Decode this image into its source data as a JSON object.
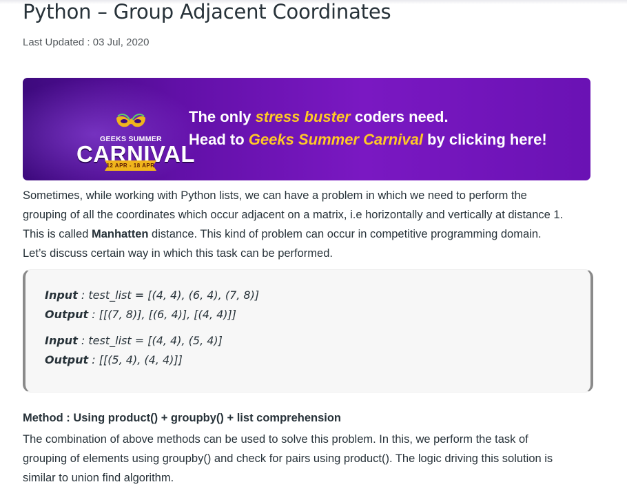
{
  "article": {
    "title": "Python – Group Adjacent Coordinates",
    "last_updated": "Last Updated : 03 Jul, 2020"
  },
  "banner": {
    "logo_line1": "GEEKS SUMMER",
    "logo_line2": "CARNIVAL",
    "logo_dates": "12 APR - 18 APR",
    "line1_start": "The only ",
    "line1_highlight": "stress buster",
    "line1_end": " coders need.",
    "line2_start": "Head to ",
    "line2_highlight": "Geeks Summer Carnival",
    "line2_end": " by clicking here!",
    "highlight_color": "#ffc926"
  },
  "intro": {
    "line1": "Sometimes, while working with Python lists, we can have a problem in which we need to perform the",
    "line2": "grouping of all the coordinates which occur adjacent on a matrix, i.e horizontally and vertically at distance 1.",
    "line3_start": "This is called ",
    "line3_bold": "Manhatten",
    "line3_end": " distance. This kind of problem can occur in competitive programming domain.",
    "line4": "Let’s discuss certain way in which this task can be performed."
  },
  "examples": [
    {
      "input_label": "Input",
      "input_text": " : test_list = [(4, 4), (6, 4), (7, 8)]",
      "output_label": "Output",
      "output_text": " : [[(7, 8)], [(6, 4)], [(4, 4)]]"
    },
    {
      "input_label": "Input",
      "input_text": " : test_list = [(4, 4), (5, 4)]",
      "output_label": "Output",
      "output_text": " : [[(5, 4), (4, 4)]]"
    }
  ],
  "method": {
    "heading": "Method : Using product() + groupby() + list comprehension",
    "line1": "The combination of above methods can be used to solve this problem. In this, we perform the task of",
    "line2": "grouping of elements using groupby() and check for pairs using product(). The logic driving this solution is",
    "line3": "similar to union find algorithm."
  },
  "colors": {
    "text": "#273239",
    "banner_purple": "#7a18c2",
    "code_border": "#8a8a8a"
  }
}
